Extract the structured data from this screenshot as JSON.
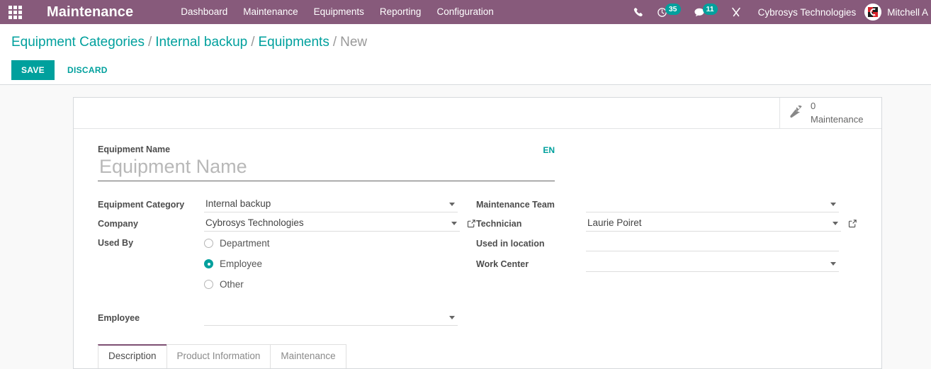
{
  "navbar": {
    "apps_icon": "apps-grid-icon",
    "brand": "Maintenance",
    "menu": [
      {
        "label": "Dashboard"
      },
      {
        "label": "Maintenance"
      },
      {
        "label": "Equipments"
      },
      {
        "label": "Reporting"
      },
      {
        "label": "Configuration"
      }
    ],
    "systray": {
      "phone_icon": "phone-icon",
      "activity_icon": "activity-clock-icon",
      "activity_count": "35",
      "messaging_icon": "chat-bubble-icon",
      "messaging_count": "11",
      "tools_icon": "wrench-screwdriver-icon",
      "company": "Cybrosys Technologies",
      "avatar_icon": "user-avatar",
      "username": "Mitchell A"
    },
    "colors": {
      "background": "#875A7B",
      "badge": "#00A09D"
    }
  },
  "control_panel": {
    "breadcrumb": [
      {
        "label": "Equipment Categories",
        "current": false
      },
      {
        "label": "Internal backup",
        "current": false
      },
      {
        "label": "Equipments",
        "current": false
      },
      {
        "label": "New",
        "current": true
      }
    ],
    "separator": "/",
    "save_label": "SAVE",
    "discard_label": "DISCARD",
    "accent": "#00A09D"
  },
  "sheet": {
    "stat_button": {
      "icon": "wrench-icon",
      "value": "0",
      "label": "Maintenance"
    },
    "title_field": {
      "label": "Equipment Name",
      "value": "",
      "placeholder": "Equipment Name",
      "lang_tag": "EN"
    },
    "left_column": [
      {
        "label": "Equipment Category",
        "type": "dropdown",
        "value": "Internal backup",
        "has_external_link": false
      },
      {
        "label": "Company",
        "type": "dropdown",
        "value": "Cybrosys Technologies",
        "has_external_link": true
      }
    ],
    "used_by": {
      "label": "Used By",
      "options": [
        {
          "label": "Department",
          "selected": false
        },
        {
          "label": "Employee",
          "selected": true
        },
        {
          "label": "Other",
          "selected": false
        }
      ]
    },
    "employee_field": {
      "label": "Employee",
      "type": "dropdown",
      "value": ""
    },
    "right_column": [
      {
        "label": "Maintenance Team",
        "type": "dropdown",
        "value": "",
        "has_external_link": false
      },
      {
        "label": "Technician",
        "type": "dropdown",
        "value": "Laurie Poiret",
        "has_external_link": true
      },
      {
        "label": "Used in location",
        "type": "text",
        "value": "",
        "has_external_link": false
      },
      {
        "label": "Work Center",
        "type": "dropdown",
        "value": "",
        "has_external_link": false
      }
    ],
    "tabs": [
      {
        "label": "Description",
        "active": true
      },
      {
        "label": "Product Information",
        "active": false
      },
      {
        "label": "Maintenance",
        "active": false
      }
    ]
  }
}
